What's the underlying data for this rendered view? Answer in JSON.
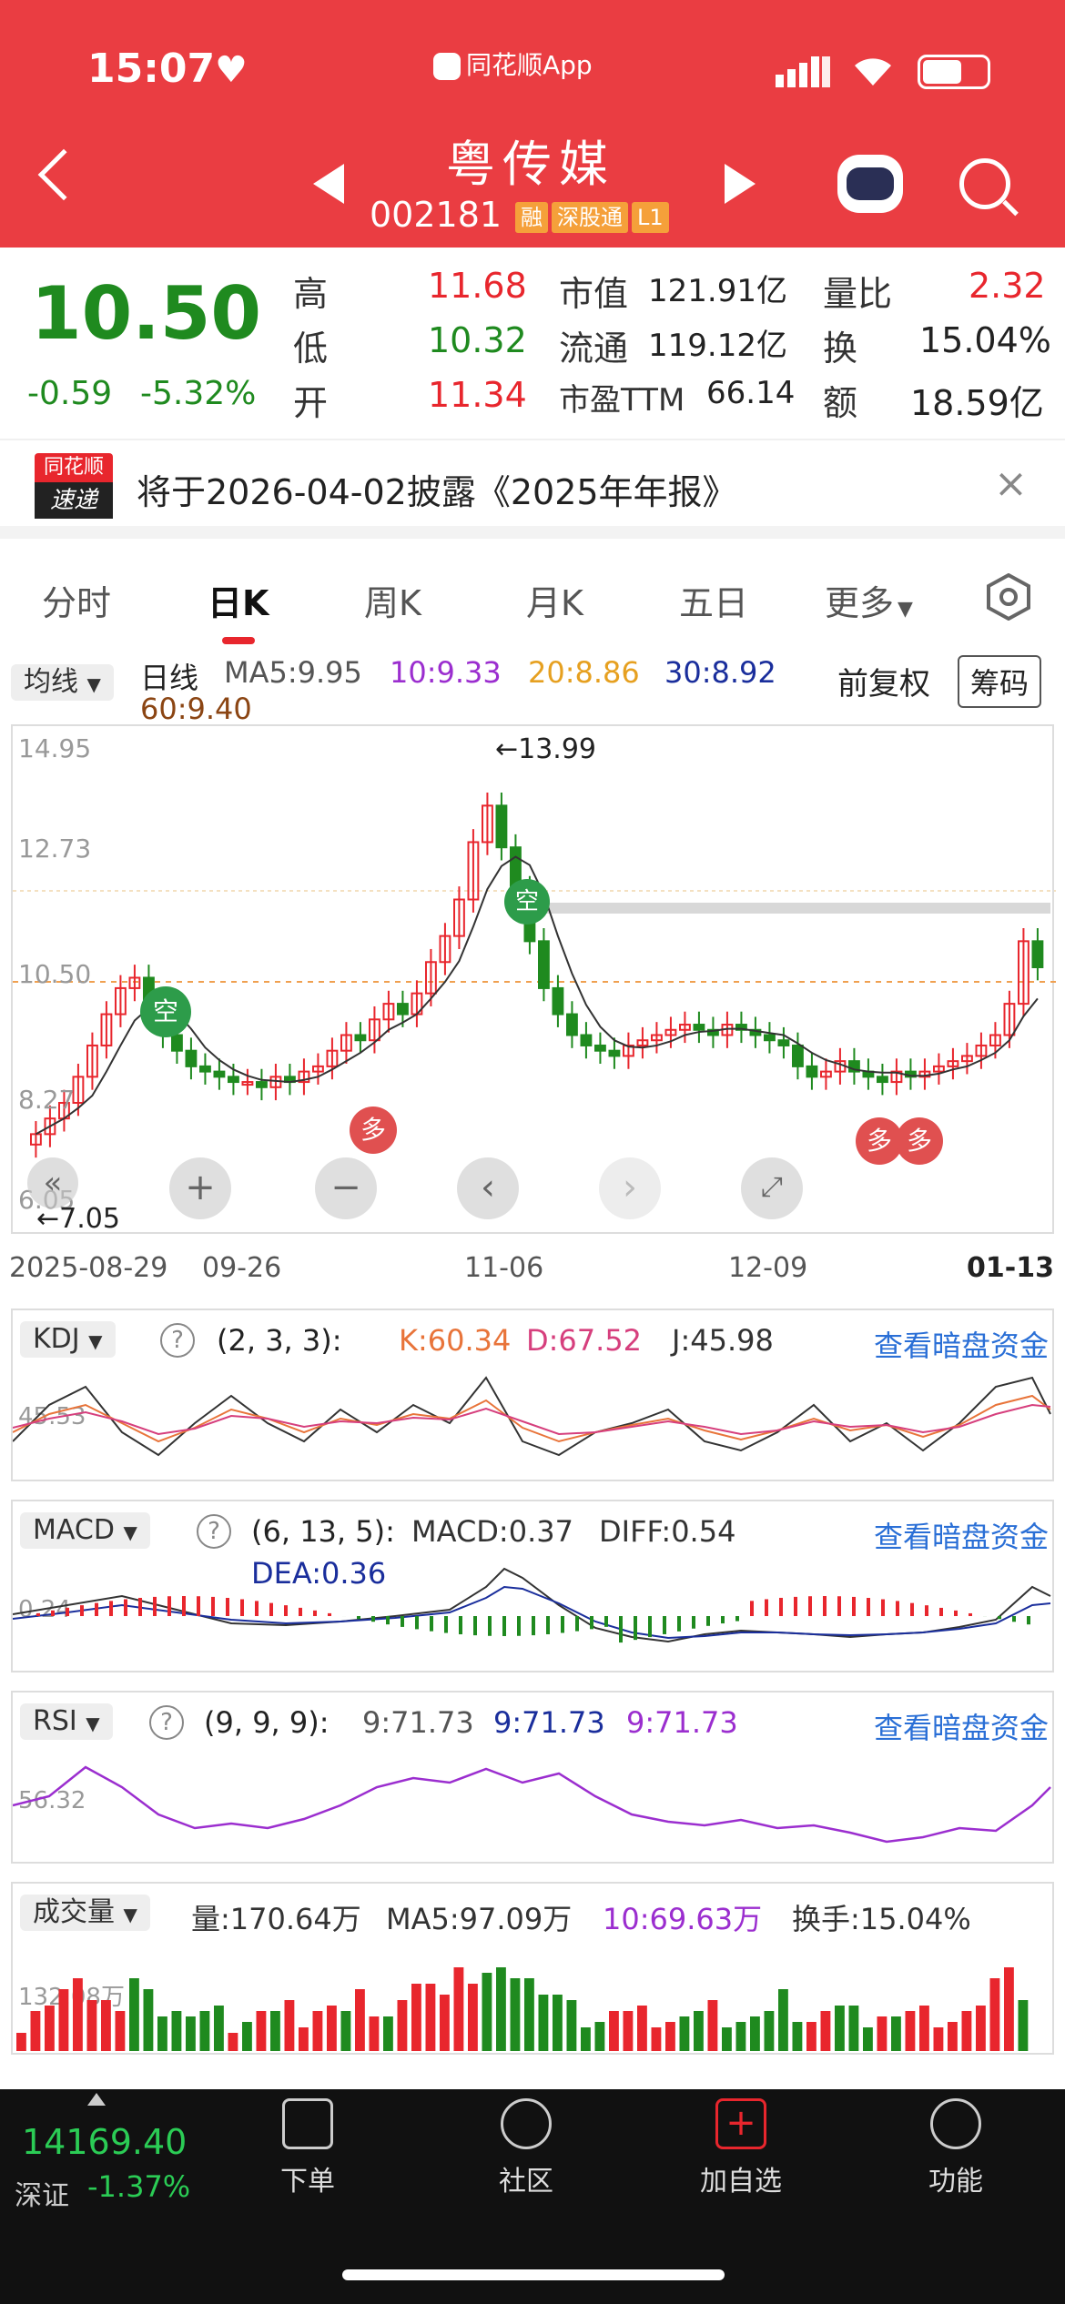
{
  "status_bar": {
    "time": "15:07",
    "app_indicator": "同花顺App"
  },
  "stock": {
    "name": "粤传媒",
    "code": "002181",
    "tags": [
      "融",
      "深股通",
      "L1"
    ]
  },
  "quote": {
    "price": "10.50",
    "change": "-0.59",
    "change_pct": "-5.32%",
    "high_label": "高",
    "high": "11.68",
    "low_label": "低",
    "low": "10.32",
    "open_label": "开",
    "open": "11.34",
    "mktcap_label": "市值",
    "mktcap": "121.91亿",
    "float_label": "流通",
    "float": "119.12亿",
    "pe_label": "市盈TTM",
    "pe": "66.14",
    "volratio_label": "量比",
    "volratio": "2.32",
    "turnover_label": "换",
    "turnover": "15.04%",
    "amount_label": "额",
    "amount": "18.59亿"
  },
  "notice": {
    "logo_top": "同花顺",
    "logo_bottom": "速递",
    "text": "将于2026-04-02披露《2025年年报》"
  },
  "tabs": [
    "分时",
    "日K",
    "周K",
    "月K",
    "五日",
    "更多"
  ],
  "active_tab": "日K",
  "kline": {
    "ma_dropdown": "均线",
    "period": "日线",
    "ma5": "MA5:9.95",
    "ma10": "10:9.33",
    "ma20": "20:8.86",
    "ma30": "30:8.92",
    "ma60": "60:9.40",
    "adjust": "前复权",
    "chips": "筹码",
    "y_ticks": [
      "14.95",
      "12.73",
      "10.50",
      "8.27",
      "6.05"
    ],
    "max_label": "←13.99",
    "min_label": "←7.05",
    "dates": [
      "2025-08-29",
      "09-26",
      "11-06",
      "12-09",
      "01-13"
    ],
    "signal_empty": "空",
    "signal_long": "多"
  },
  "kdj": {
    "name": "KDJ",
    "params": "(2, 3, 3):",
    "k": "K:60.34",
    "d": "D:67.52",
    "j": "J:45.98",
    "axis": "45.53",
    "link": "查看暗盘资金"
  },
  "macd": {
    "name": "MACD",
    "params": "(6, 13, 5):",
    "macd": "MACD:0.37",
    "diff": "DIFF:0.54",
    "dea": "DEA:0.36",
    "axis": "0.24",
    "link": "查看暗盘资金"
  },
  "rsi": {
    "name": "RSI",
    "params": "(9, 9, 9):",
    "r1": "9:71.73",
    "r2": "9:71.73",
    "r3": "9:71.73",
    "axis": "56.32",
    "link": "查看暗盘资金"
  },
  "volume": {
    "name": "成交量",
    "vol": "量:170.64万",
    "ma5": "MA5:97.09万",
    "ma10": "10:69.63万",
    "turnover": "换手:15.04%",
    "axis": "132.08万"
  },
  "bottom": {
    "index_value": "14169.40",
    "index_name": "深证",
    "index_change": "-1.37%",
    "nav": [
      "下单",
      "社区",
      "加自选",
      "功能"
    ]
  },
  "colors": {
    "header": "#ea3d42",
    "up": "#e8262d",
    "down": "#1f8a1f",
    "link": "#2a6fd6"
  },
  "chart_data": {
    "type": "candlestick",
    "title": "粤传媒 日线",
    "x_range": [
      "2025-08-29",
      "01-13"
    ],
    "ylim": [
      6.05,
      14.95
    ],
    "closes": [
      7.3,
      7.6,
      7.9,
      8.4,
      9.0,
      9.6,
      10.1,
      10.3,
      9.6,
      9.2,
      8.9,
      8.6,
      8.5,
      8.4,
      8.3,
      8.3,
      8.2,
      8.4,
      8.3,
      8.5,
      8.6,
      8.9,
      9.2,
      9.1,
      9.5,
      9.8,
      9.6,
      10.0,
      10.6,
      11.1,
      11.8,
      12.9,
      13.6,
      12.8,
      12.0,
      11.0,
      10.1,
      9.6,
      9.2,
      9.0,
      8.9,
      8.8,
      9.0,
      9.1,
      9.2,
      9.3,
      9.4,
      9.3,
      9.2,
      9.4,
      9.3,
      9.2,
      9.1,
      9.0,
      8.6,
      8.4,
      8.5,
      8.7,
      8.5,
      8.4,
      8.3,
      8.5,
      8.4,
      8.5,
      8.6,
      8.7,
      8.8,
      9.0,
      9.2,
      9.8,
      11.0,
      10.5
    ]
  }
}
